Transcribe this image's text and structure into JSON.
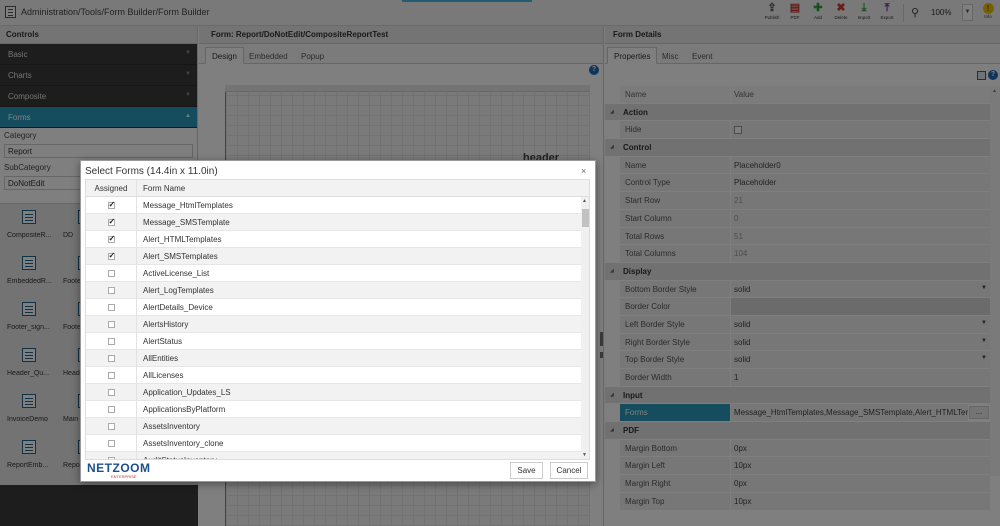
{
  "topbar": {
    "breadcrumb": "Administration/Tools/Form Builder/Form Builder",
    "buttons": [
      {
        "label": "Publish",
        "icon": "publish-icon"
      },
      {
        "label": "PDF",
        "icon": "pdf-icon"
      },
      {
        "label": "Add",
        "icon": "add-icon"
      },
      {
        "label": "Delete",
        "icon": "delete-icon"
      },
      {
        "label": "Import",
        "icon": "import-icon"
      },
      {
        "label": "Export",
        "icon": "export-icon"
      }
    ],
    "zoom": "100%",
    "info_label": "Info"
  },
  "controls": {
    "title": "Controls",
    "sections": [
      "Basic",
      "Charts",
      "Composite",
      "Forms"
    ],
    "category_label": "Category",
    "category_value": "Report",
    "subcategory_label": "SubCategory",
    "subcategory_value": "DoNotEdit",
    "tiles": [
      "CompositeR...",
      "DD",
      "EmbeddedR...",
      "Foote",
      "Footer_sign...",
      "Foote",
      "Header_Qu...",
      "Head",
      "InvoiceDemo",
      "Main",
      "ReportEmb...",
      "Repo"
    ]
  },
  "form": {
    "title": "Form: Report/DoNotEdit/CompositeReportTest",
    "tabs": [
      "Design",
      "Embedded",
      "Popup"
    ],
    "canvas_header": "header"
  },
  "details": {
    "title": "Form Details",
    "tabs": [
      "Properties",
      "Misc",
      "Event"
    ],
    "col_name": "Name",
    "col_value": "Value",
    "rows": [
      {
        "type": "cat",
        "name": "Action"
      },
      {
        "type": "prop",
        "name": "Hide",
        "value": "",
        "checkbox": true
      },
      {
        "type": "cat",
        "name": "Control"
      },
      {
        "type": "prop",
        "name": "Name",
        "value": "Placeholder0"
      },
      {
        "type": "prop",
        "name": "Control Type",
        "value": "Placeholder"
      },
      {
        "type": "prop",
        "name": "Start Row",
        "value": "21",
        "muted": true
      },
      {
        "type": "prop",
        "name": "Start Column",
        "value": "0",
        "muted": true
      },
      {
        "type": "prop",
        "name": "Total Rows",
        "value": "51",
        "muted": true
      },
      {
        "type": "prop",
        "name": "Total Columns",
        "value": "104",
        "muted": true
      },
      {
        "type": "cat",
        "name": "Display"
      },
      {
        "type": "prop",
        "name": "Bottom Border Style",
        "value": "solid",
        "dropdown": true
      },
      {
        "type": "prop",
        "name": "Border Color",
        "value": ""
      },
      {
        "type": "prop",
        "name": "Left Border Style",
        "value": "solid",
        "dropdown": true
      },
      {
        "type": "prop",
        "name": "Right Border Style",
        "value": "solid",
        "dropdown": true
      },
      {
        "type": "prop",
        "name": "Top Border Style",
        "value": "solid",
        "dropdown": true
      },
      {
        "type": "prop",
        "name": "Border Width",
        "value": "1"
      },
      {
        "type": "cat",
        "name": "Input"
      },
      {
        "type": "prop",
        "name": "Forms",
        "value": "Message_HtmlTemplates,Message_SMSTemplate,Alert_HTMLTempl",
        "selected": true,
        "ellipsis": "..."
      },
      {
        "type": "cat",
        "name": "PDF"
      },
      {
        "type": "prop",
        "name": "Margin Bottom",
        "value": "0px"
      },
      {
        "type": "prop",
        "name": "Margin Left",
        "value": "10px"
      },
      {
        "type": "prop",
        "name": "Margin Right",
        "value": "0px"
      },
      {
        "type": "prop",
        "name": "Margin Top",
        "value": "10px"
      }
    ]
  },
  "modal": {
    "title": "Select Forms (14.4in x 11.0in)",
    "close": "×",
    "col_assigned": "Assigned",
    "col_form": "Form Name",
    "rows": [
      {
        "name": "Message_HtmlTemplates",
        "assigned": true
      },
      {
        "name": "Message_SMSTemplate",
        "assigned": true
      },
      {
        "name": "Alert_HTMLTemplates",
        "assigned": true
      },
      {
        "name": "Alert_SMSTemplates",
        "assigned": true
      },
      {
        "name": "ActiveLicense_List",
        "assigned": false
      },
      {
        "name": "Alert_LogTemplates",
        "assigned": false
      },
      {
        "name": "AlertDetails_Device",
        "assigned": false
      },
      {
        "name": "AlertsHistory",
        "assigned": false
      },
      {
        "name": "AlertStatus",
        "assigned": false
      },
      {
        "name": "AllEntities",
        "assigned": false
      },
      {
        "name": "AllLicenses",
        "assigned": false
      },
      {
        "name": "Application_Updates_LS",
        "assigned": false
      },
      {
        "name": "ApplicationsByPlatform",
        "assigned": false
      },
      {
        "name": "AssetsInventory",
        "assigned": false
      },
      {
        "name": "AssetsInventory_clone",
        "assigned": false
      },
      {
        "name": "AuditStatusInventory",
        "assigned": false
      }
    ],
    "logo_brand": "NETZOOM",
    "logo_sub": "ENTERPRISE",
    "save_label": "Save",
    "cancel_label": "Cancel"
  },
  "colors": {
    "accent": "#2a9bbf",
    "dark": "#3a3a3a",
    "add": "#2e9e3e",
    "delete": "#d63b2f",
    "import": "#2e9e3e",
    "export": "#6c3fa0"
  }
}
